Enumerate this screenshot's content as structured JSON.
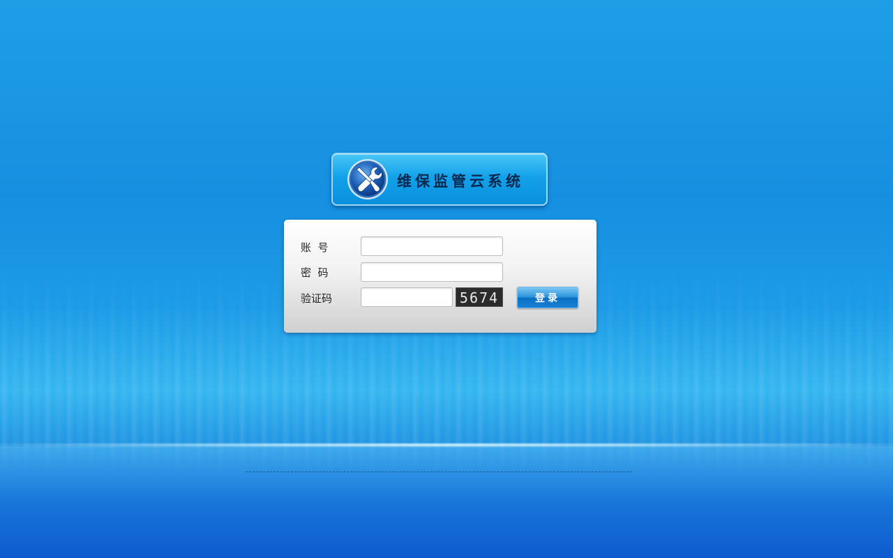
{
  "app": {
    "title": "维保监管云系统"
  },
  "login": {
    "account_label": "账  号",
    "password_label": "密  码",
    "captcha_label": "验证码",
    "account_value": "",
    "password_value": "",
    "captcha_value": "",
    "captcha_code": "5674",
    "login_button": "登录"
  },
  "icons": {
    "logo": "wrench-screwdriver-icon"
  },
  "colors": {
    "background": "#168fe0",
    "badge": "#13a2ea",
    "button": "#2b94dc"
  }
}
